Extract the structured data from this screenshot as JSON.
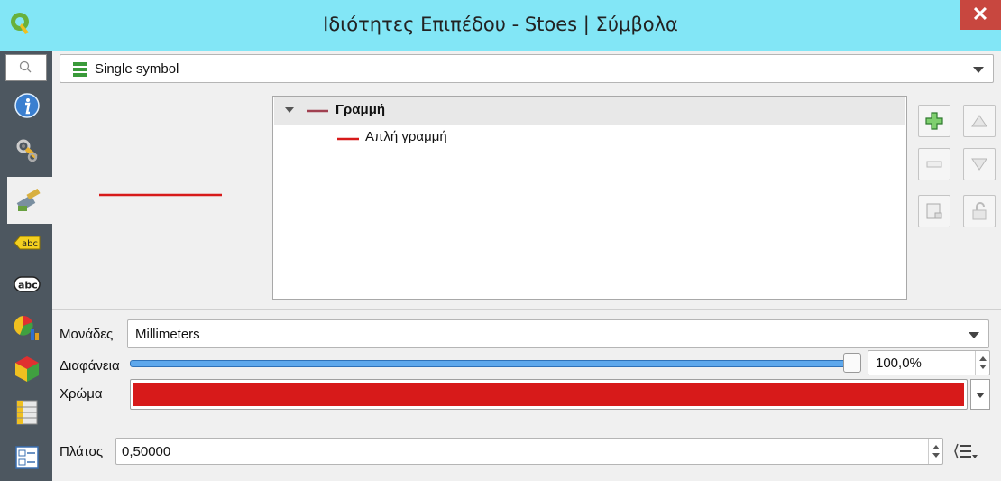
{
  "window": {
    "title": "Ιδιότητες Επιπέδου - Stoes | Σύμβολα",
    "close_glyph": "✕"
  },
  "sidebar": {
    "items": [
      {
        "icon": "info-icon"
      },
      {
        "icon": "source-settings-icon"
      },
      {
        "icon": "symbology-brush-icon",
        "active": true
      },
      {
        "icon": "labels-abc-icon",
        "text": "abc"
      },
      {
        "icon": "mask-abc-icon",
        "text": "abc"
      },
      {
        "icon": "diagrams-icon"
      },
      {
        "icon": "3d-view-icon"
      },
      {
        "icon": "fields-icon"
      },
      {
        "icon": "attributes-form-icon"
      }
    ]
  },
  "renderer": {
    "value": "Single symbol"
  },
  "symbol_tree": {
    "root_label": "Γραμμή",
    "child_label": "Απλή γραμμή",
    "line_color": "#d71a1a",
    "root_line_color": "#a04050"
  },
  "units": {
    "label": "Μονάδες",
    "value": "Millimeters"
  },
  "opacity": {
    "label": "Διαφάνεια",
    "value": "100,0%",
    "level": 1.0
  },
  "color": {
    "label": "Χρώμα",
    "value": "#d71a1a"
  },
  "width": {
    "label": "Πλάτος",
    "value": "0,50000"
  }
}
